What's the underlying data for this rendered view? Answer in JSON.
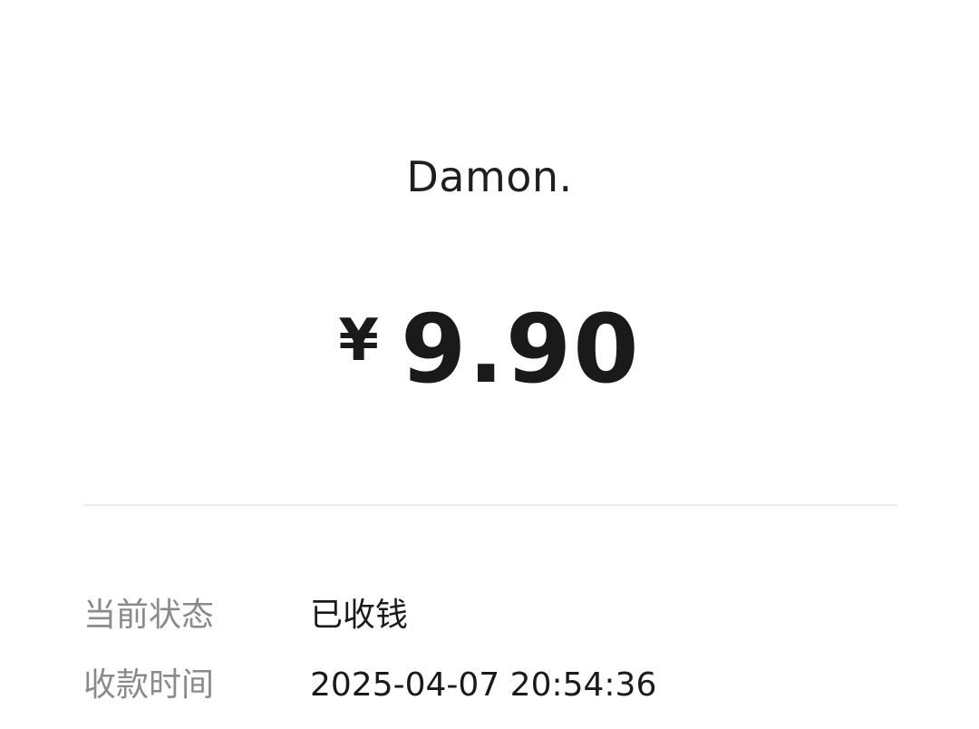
{
  "payment": {
    "payer_name": "Damon.",
    "currency_symbol": "¥",
    "amount": "9.90"
  },
  "details": {
    "status": {
      "label": "当前状态",
      "value": "已收钱"
    },
    "time": {
      "label": "收款时间",
      "value": "2025-04-07 20:54:36"
    }
  },
  "colors": {
    "background": "#ffffff",
    "primary_text": "#1a1a1a",
    "secondary_text": "#8a8a8a",
    "divider": "#ececec"
  }
}
